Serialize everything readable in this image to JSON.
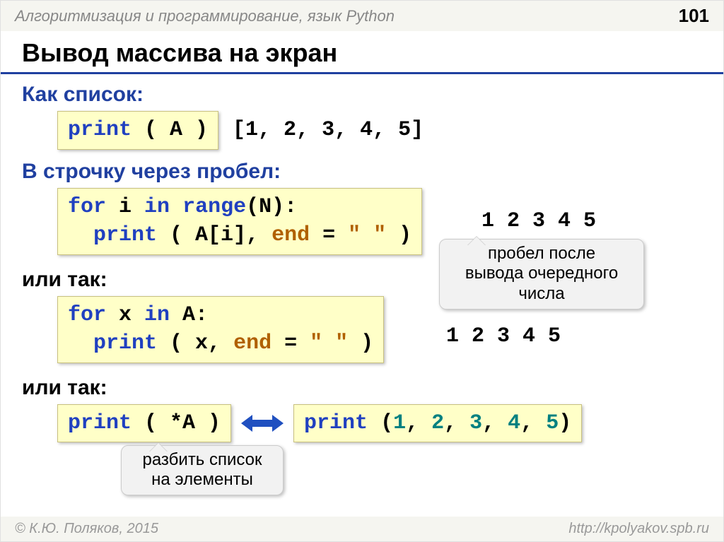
{
  "header": {
    "breadcrumb": "Алгоритмизация и программирование, язык Python",
    "page": "101"
  },
  "title": "Вывод массива на экран",
  "s1": {
    "heading": "Как список:",
    "code_kw": "print",
    "code_rest": " ( A )",
    "output": "[1, 2, 3, 4, 5]"
  },
  "s2": {
    "heading": "В строчку через пробел:",
    "l1a": "for",
    "l1b": " i ",
    "l1c": "in",
    "l1d": " ",
    "l1e": "range",
    "l1f": "(N):",
    "l2a": "  print",
    "l2b": " ( A[i], ",
    "l2c": "end",
    "l2d": " = ",
    "l2e": "\" \"",
    "l2f": " )",
    "output": "1 2 3 4 5",
    "callout": "пробел после\nвывода очередного\nчисла"
  },
  "s3": {
    "heading": "или так:",
    "l1a": "for",
    "l1b": " x ",
    "l1c": "in",
    "l1d": " A:",
    "l2a": "  print",
    "l2b": " ( x, ",
    "l2c": "end",
    "l2d": " = ",
    "l2e": "\" \"",
    "l2f": " )",
    "output": "1 2 3 4 5"
  },
  "s4": {
    "heading": "или так:",
    "left_kw": "print",
    "left_rest": " ( *A )",
    "right_kw": "print",
    "right_open": " (",
    "n1": "1",
    "n2": "2",
    "n3": "3",
    "n4": "4",
    "n5": "5",
    "sep": ", ",
    "right_close": ")",
    "callout": "разбить список\nна элементы"
  },
  "footer": {
    "left": "© К.Ю. Поляков, 2015",
    "right": "http://kpolyakov.spb.ru"
  }
}
